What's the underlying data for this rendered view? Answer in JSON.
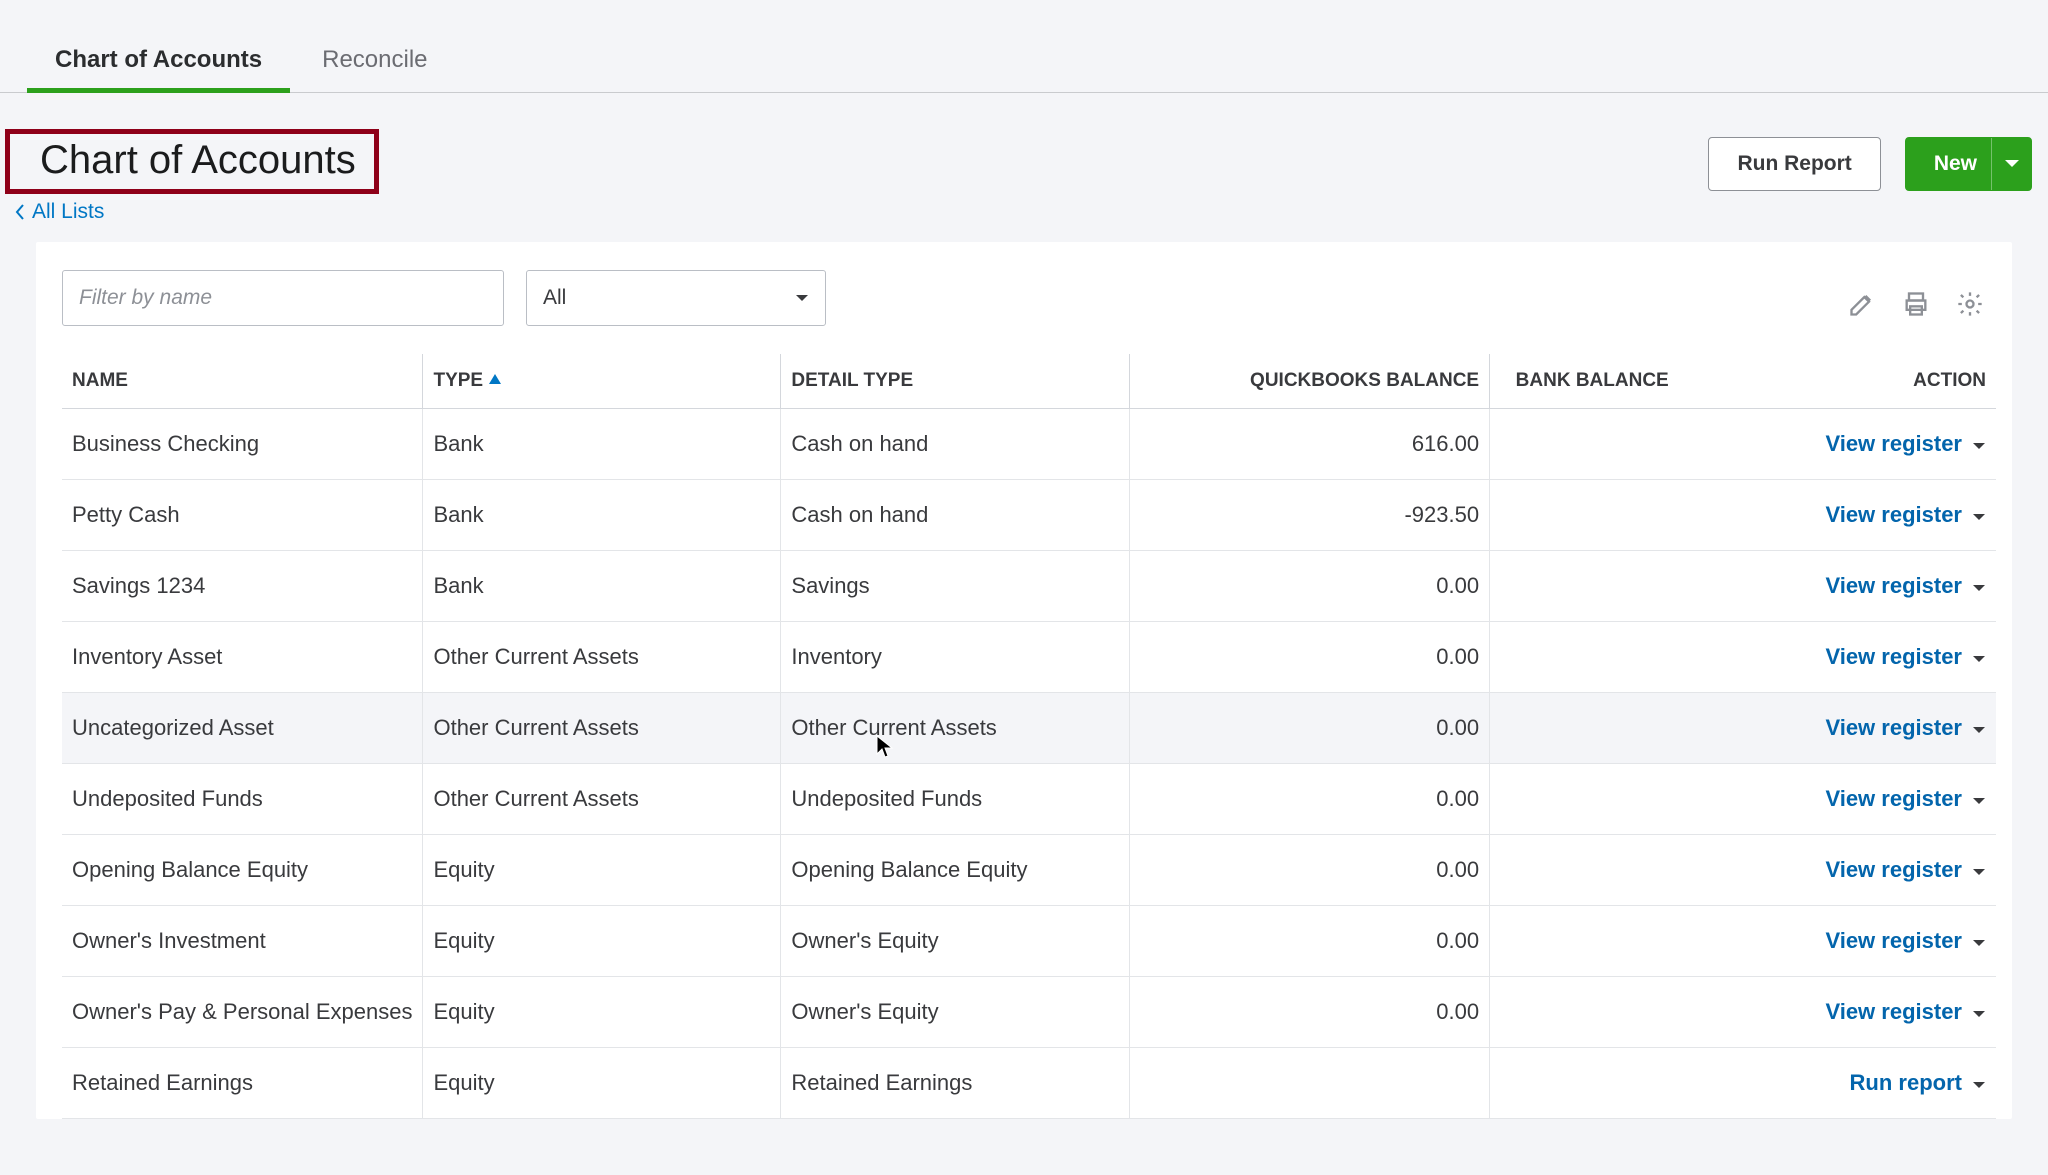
{
  "tabs": {
    "chart": "Chart of Accounts",
    "reconcile": "Reconcile"
  },
  "page": {
    "title": "Chart of Accounts",
    "back_link": "All Lists"
  },
  "header_buttons": {
    "run_report": "Run Report",
    "new": "New"
  },
  "toolbar": {
    "filter_placeholder": "Filter by name",
    "select_label": "All"
  },
  "columns": {
    "name": "NAME",
    "type": "TYPE",
    "detail": "DETAIL TYPE",
    "qb_balance": "QUICKBOOKS BALANCE",
    "bank_balance": "BANK BALANCE",
    "action": "ACTION"
  },
  "actions": {
    "view_register": "View register",
    "run_report": "Run report"
  },
  "rows": [
    {
      "name": "Business Checking",
      "type": "Bank",
      "detail": "Cash on hand",
      "qb": "616.00",
      "bank": "",
      "action": "view_register"
    },
    {
      "name": "Petty Cash",
      "type": "Bank",
      "detail": "Cash on hand",
      "qb": "-923.50",
      "bank": "",
      "action": "view_register"
    },
    {
      "name": "Savings 1234",
      "type": "Bank",
      "detail": "Savings",
      "qb": "0.00",
      "bank": "",
      "action": "view_register"
    },
    {
      "name": "Inventory Asset",
      "type": "Other Current Assets",
      "detail": "Inventory",
      "qb": "0.00",
      "bank": "",
      "action": "view_register"
    },
    {
      "name": "Uncategorized Asset",
      "type": "Other Current Assets",
      "detail": "Other Current Assets",
      "qb": "0.00",
      "bank": "",
      "action": "view_register",
      "hover": true
    },
    {
      "name": "Undeposited Funds",
      "type": "Other Current Assets",
      "detail": "Undeposited Funds",
      "qb": "0.00",
      "bank": "",
      "action": "view_register"
    },
    {
      "name": "Opening Balance Equity",
      "type": "Equity",
      "detail": "Opening Balance Equity",
      "qb": "0.00",
      "bank": "",
      "action": "view_register"
    },
    {
      "name": "Owner's Investment",
      "type": "Equity",
      "detail": "Owner's Equity",
      "qb": "0.00",
      "bank": "",
      "action": "view_register"
    },
    {
      "name": "Owner's Pay & Personal Expenses",
      "type": "Equity",
      "detail": "Owner's Equity",
      "qb": "0.00",
      "bank": "",
      "action": "view_register"
    },
    {
      "name": "Retained Earnings",
      "type": "Equity",
      "detail": "Retained Earnings",
      "qb": "",
      "bank": "",
      "action": "run_report"
    }
  ]
}
